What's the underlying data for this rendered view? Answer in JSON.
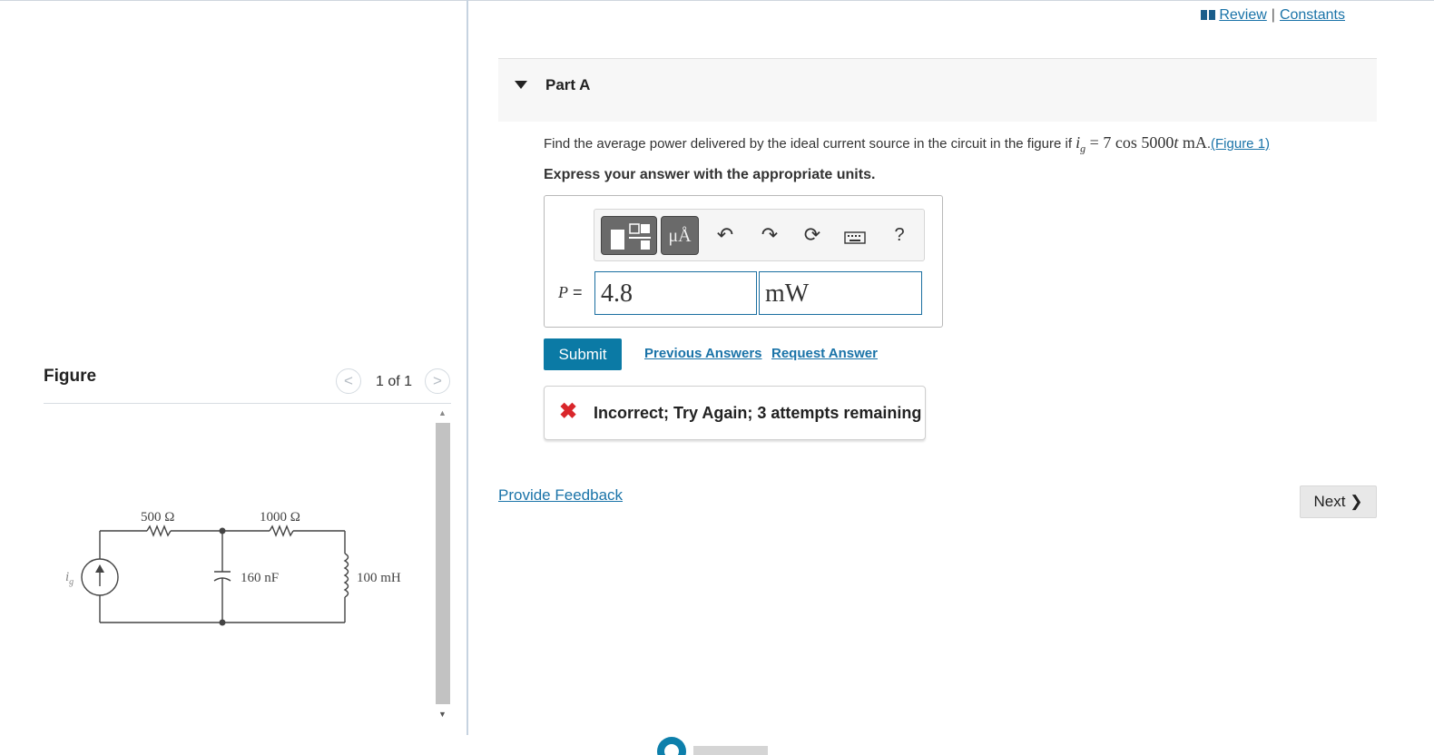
{
  "header": {
    "review_label": "Review",
    "separator": "|",
    "constants_label": "Constants"
  },
  "figure_panel": {
    "title": "Figure",
    "pager_text": "1 of 1",
    "prev_glyph": "<",
    "next_glyph": ">"
  },
  "circuit": {
    "source_label": "i",
    "source_subscript": "g",
    "r1": "500 Ω",
    "r2": "1000 Ω",
    "capacitor": "160 nF",
    "inductor": "100 mH"
  },
  "part": {
    "title": "Part A",
    "question_text": "Find the average power delivered by the ideal current source in the circuit in the figure if ",
    "math_var": "i",
    "math_sub": "g",
    "math_rhs_pre": " = 7 cos 5000",
    "math_t": "t",
    "math_unit": " mA",
    "question_end": ".",
    "figure_link": "(Figure 1)",
    "instruction": "Express your answer with the appropriate units."
  },
  "answer": {
    "variable": "P",
    "equals": "=",
    "value": "4.8",
    "unit": "mW",
    "toolbar": {
      "units_button_label": "μÅ",
      "help_label": "?"
    }
  },
  "actions": {
    "submit_label": "Submit",
    "previous_answers_label": "Previous Answers",
    "request_answer_label": "Request Answer"
  },
  "feedback": {
    "icon_glyph": "✖",
    "message": "Incorrect; Try Again; 3 attempts remaining"
  },
  "footer": {
    "provide_feedback_label": "Provide Feedback",
    "next_label": "Next",
    "next_glyph": "❯"
  },
  "colors": {
    "link": "#1a73a8",
    "submit_bg": "#0b7aa5",
    "error": "#d9262b"
  }
}
